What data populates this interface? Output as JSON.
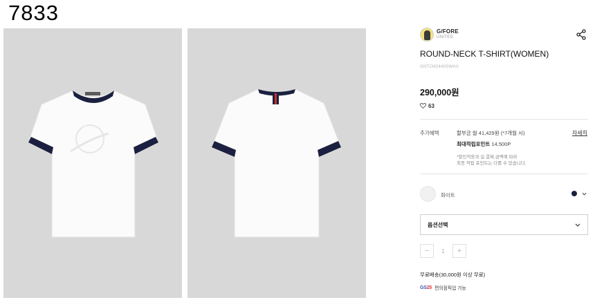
{
  "overlay": {
    "id_text": "7833"
  },
  "images": {
    "front_alt": "front-product-photo",
    "back_alt": "back-product-photo",
    "neck_tag_text": "G/FORE"
  },
  "brand": {
    "name": "G/FORE",
    "sub": "UNITED"
  },
  "product": {
    "title": "ROUND-NECK T-SHIRT(WOMEN)",
    "sku": "GNTCM2440SWHX",
    "price": "290,000원",
    "likes": "63"
  },
  "benefits": {
    "label": "추가혜택",
    "installment": "할부금 월 41,429원 (*7개월 시)",
    "points_label": "최대적립포인트",
    "points_value": "14,500P",
    "note_1": "*할인적용과 실 결제 금액에 따라",
    "note_2": "최종 적립 포인트는 다를 수 있습니다.",
    "detail_link": "자세히"
  },
  "color": {
    "selected_name": "화이트",
    "dot_color": "#1b2040"
  },
  "option_select": {
    "label": "옵션선택"
  },
  "quantity": {
    "minus": "−",
    "value": "1",
    "plus": "+"
  },
  "shipping": {
    "text": "무료배송(30,000원 이상 무료)"
  },
  "pickup": {
    "logo_gs": "GS",
    "logo_num": "25",
    "text": "편의점픽업 가능"
  },
  "colors": {
    "navy": "#1b2040",
    "photo_bg": "#d8d8d8",
    "shirt": "#fafafa"
  }
}
